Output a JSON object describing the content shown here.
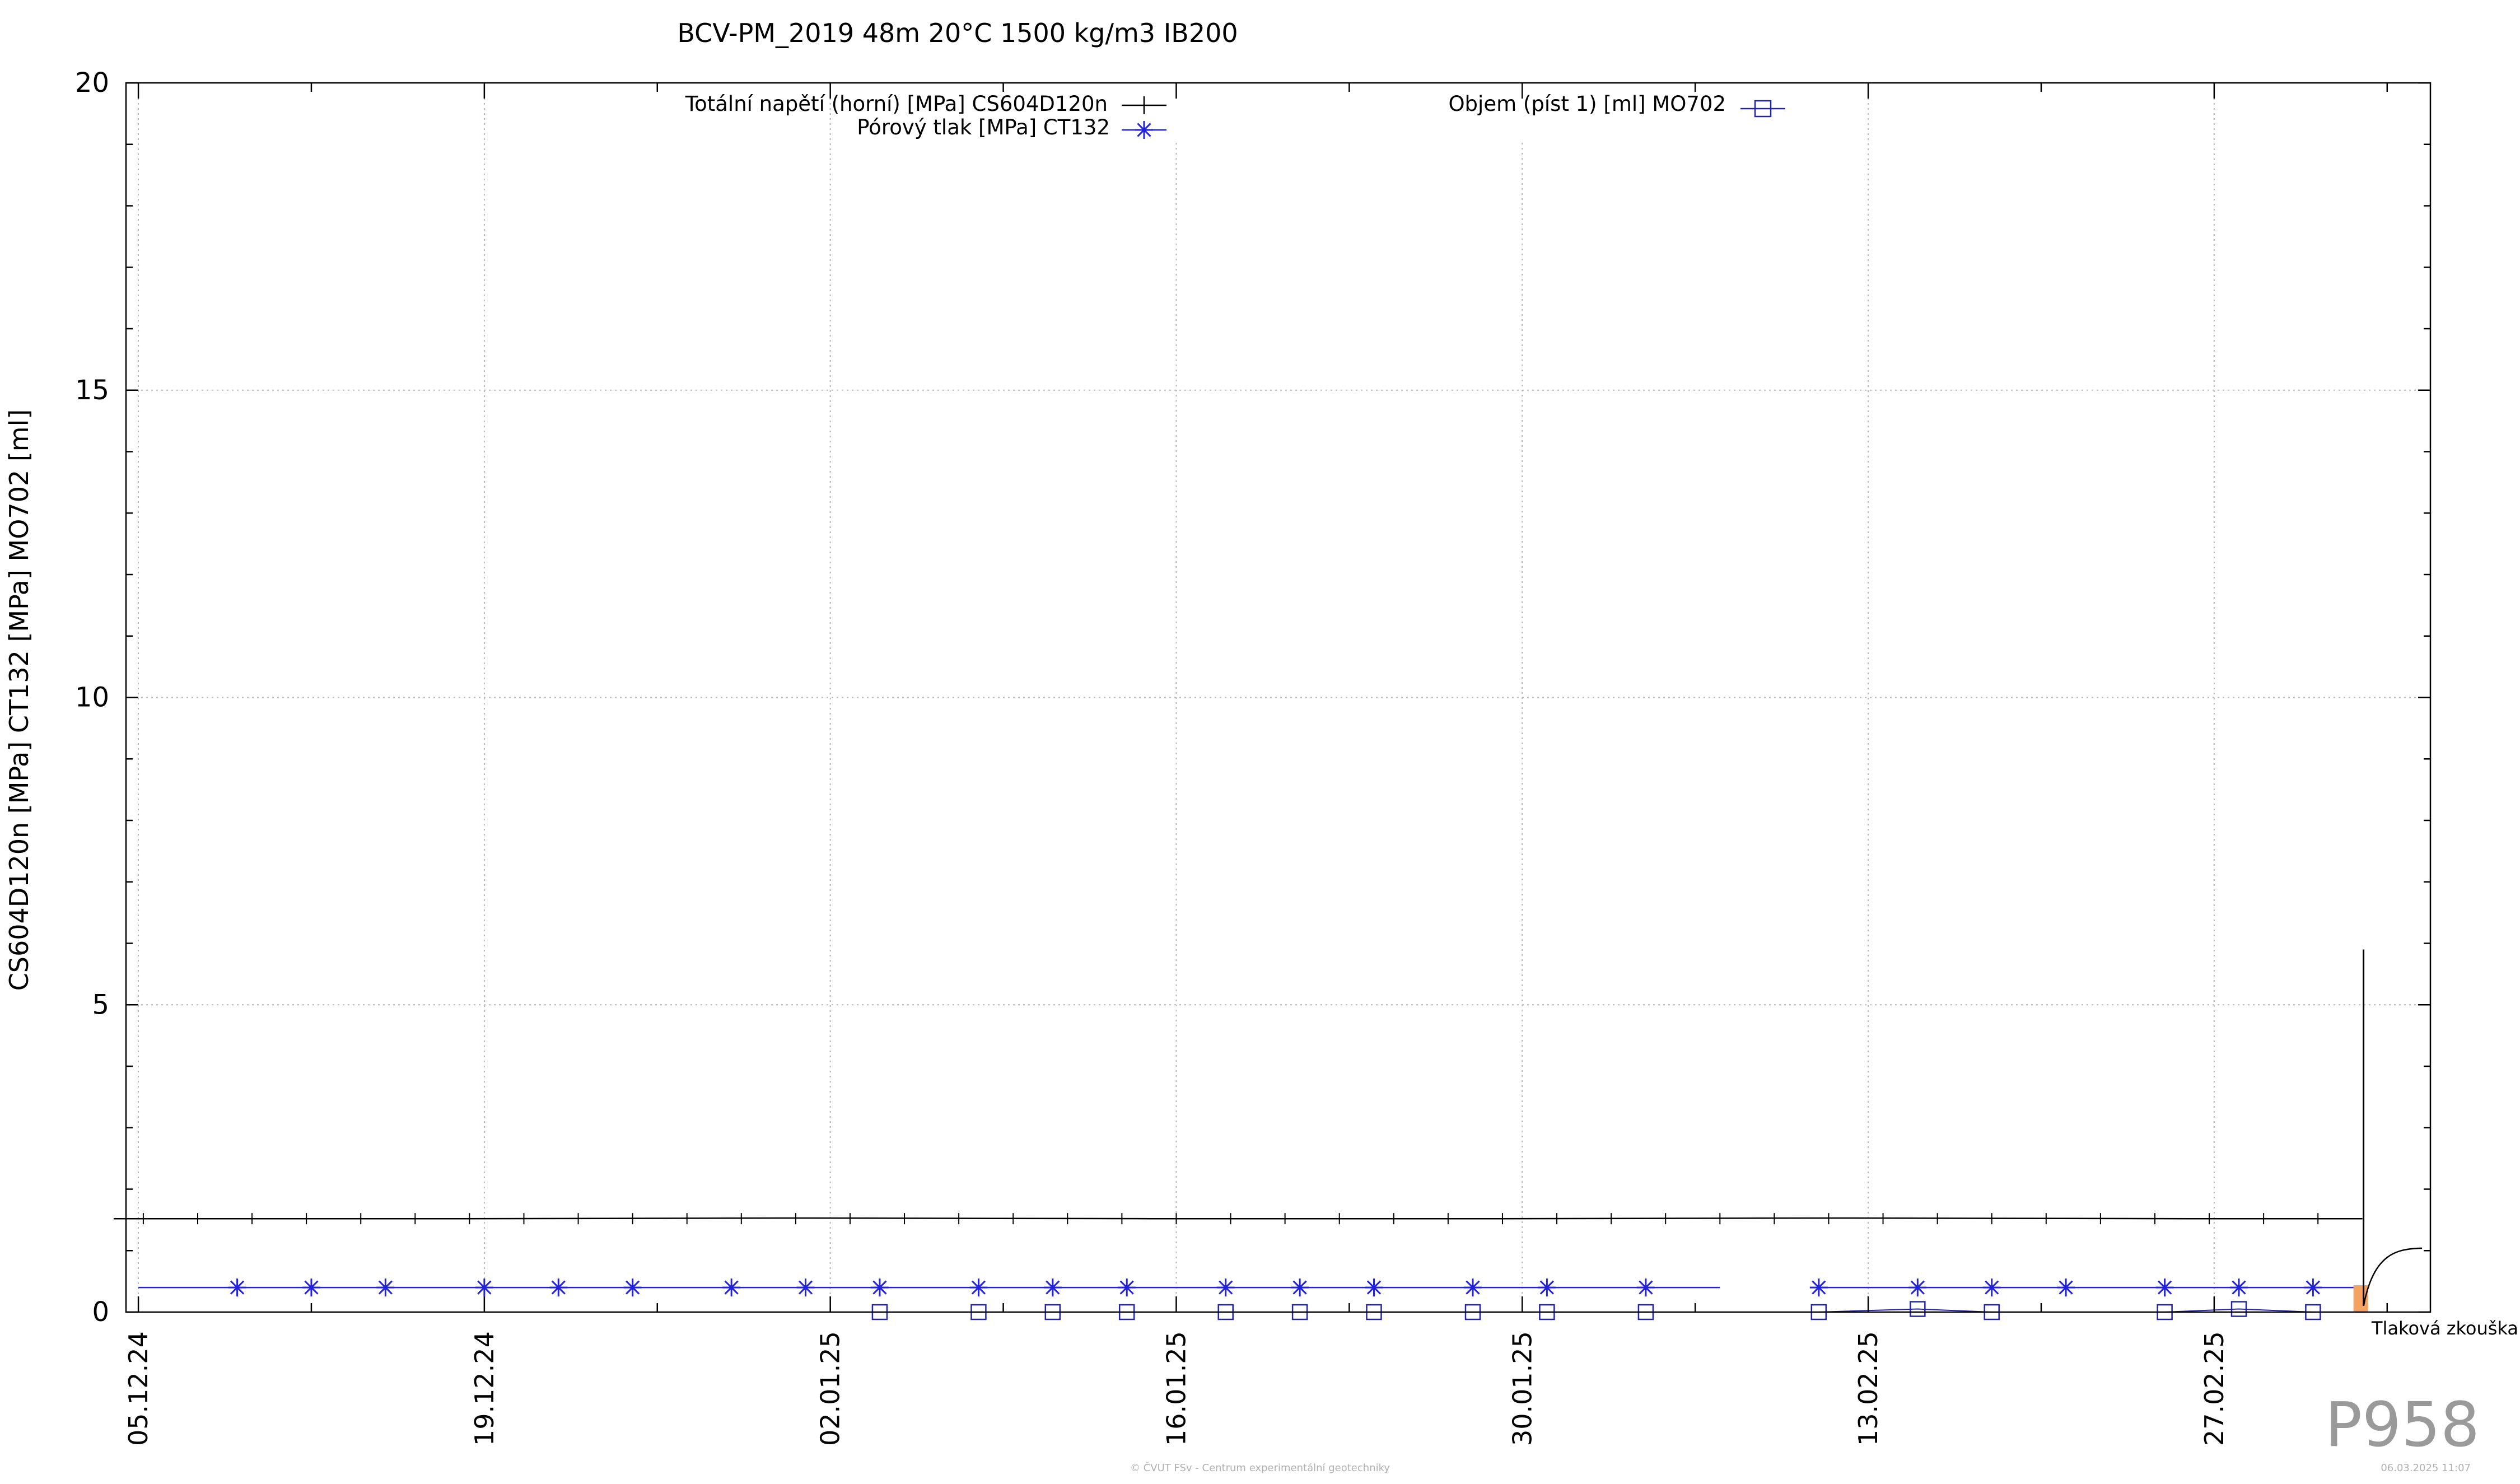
{
  "chart_data": {
    "type": "line",
    "title": "BCV-PM_2019 48m 20°C 1500 kg/m3 IB200",
    "xlabel": "",
    "ylabel": "CS604D120n [MPa] CT132 [MPa] MO702 [ml]",
    "ylim": [
      0,
      20
    ],
    "yticks": [
      0,
      5,
      10,
      15,
      20
    ],
    "x_range": [
      "2024-12-05",
      "2025-03-06"
    ],
    "xticks": [
      {
        "date": "2024-12-05",
        "label": "05.12.24"
      },
      {
        "date": "2024-12-19",
        "label": "19.12.24"
      },
      {
        "date": "2025-01-02",
        "label": "02.01.25"
      },
      {
        "date": "2025-01-16",
        "label": "16.01.25"
      },
      {
        "date": "2025-01-30",
        "label": "30.01.25"
      },
      {
        "date": "2025-02-13",
        "label": "13.02.25"
      },
      {
        "date": "2025-02-27",
        "label": "27.02.25"
      }
    ],
    "grid": true,
    "legend_placement": "top",
    "series": [
      {
        "name": "Totální napětí (horní) [MPa] CS604D120n",
        "color": "#000000",
        "marker": "plus",
        "points": [
          [
            "2024-12-04",
            1.52
          ],
          [
            "2024-12-10",
            1.52
          ],
          [
            "2024-12-18",
            1.52
          ],
          [
            "2025-01-01",
            1.53
          ],
          [
            "2025-01-15",
            1.52
          ],
          [
            "2025-01-29",
            1.52
          ],
          [
            "2025-02-12",
            1.53
          ],
          [
            "2025-02-26",
            1.52
          ],
          [
            "2025-03-05",
            1.52
          ]
        ]
      },
      {
        "name": "Pórový tlak [MPa] CT132",
        "color": "#2222dd",
        "marker": "star",
        "points": [
          [
            "2024-12-05",
            0.4
          ],
          [
            "2025-02-07",
            0.4
          ],
          [
            "2025-02-11",
            0.4
          ],
          [
            "2025-03-05",
            0.4
          ]
        ],
        "marker_dates": [
          "2024-12-09",
          "2024-12-12",
          "2024-12-15",
          "2024-12-19",
          "2024-12-22",
          "2024-12-25",
          "2024-12-29",
          "2025-01-01",
          "2025-01-04",
          "2025-01-08",
          "2025-01-11",
          "2025-01-14",
          "2025-01-18",
          "2025-01-21",
          "2025-01-24",
          "2025-01-28",
          "2025-01-31",
          "2025-02-04",
          "2025-02-11",
          "2025-02-15",
          "2025-02-18",
          "2025-02-21",
          "2025-02-25",
          "2025-02-28",
          "2025-03-03"
        ]
      },
      {
        "name": "Objem (píst 1) [ml] MO702",
        "color": "#2222aa",
        "marker": "square",
        "points": [
          [
            "2025-01-04",
            0.0
          ],
          [
            "2025-02-04",
            0.0
          ],
          [
            "2025-02-11",
            0.0
          ],
          [
            "2025-02-15",
            0.05
          ],
          [
            "2025-02-18",
            0.0
          ],
          [
            "2025-02-25",
            0.0
          ],
          [
            "2025-02-28",
            0.05
          ],
          [
            "2025-03-03",
            0.0
          ]
        ],
        "marker_dates": [
          "2025-01-04",
          "2025-01-08",
          "2025-01-11",
          "2025-01-14",
          "2025-01-18",
          "2025-01-21",
          "2025-01-24",
          "2025-01-28",
          "2025-01-31",
          "2025-02-04",
          "2025-02-11",
          "2025-02-15",
          "2025-02-18",
          "2025-02-25",
          "2025-02-28",
          "2025-03-03"
        ]
      }
    ],
    "event": {
      "label": "Tlaková zkouška",
      "date": "2025-03-05",
      "color": "#f4a261",
      "spike": [
        [
          "2025-03-05",
          1.52
        ],
        [
          "2025-03-05",
          5.9
        ],
        [
          "2025-03-05",
          0.1
        ]
      ],
      "recovery": [
        [
          "2025-03-05",
          0.1
        ],
        [
          "2025-03-05",
          0.8
        ],
        [
          "2025-03-06",
          1.0
        ],
        [
          "2025-03-07",
          1.05
        ]
      ]
    }
  },
  "watermark": "P958",
  "footer": {
    "copyright": "© ČVUT FSv - Centrum experimentální geotechniky",
    "timestamp": "06.03.2025 11:07"
  }
}
